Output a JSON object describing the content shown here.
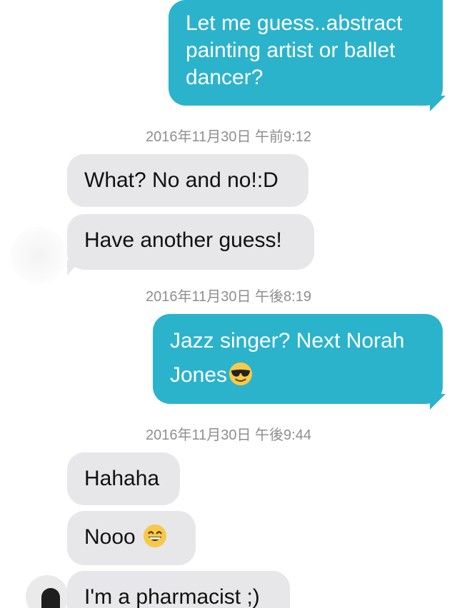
{
  "messages": [
    {
      "kind": "sent",
      "text": "Let me guess..abstract painting artist or ballet dancer?"
    },
    {
      "kind": "timestamp",
      "text": "2016年11月30日 午前9:12"
    },
    {
      "kind": "recv",
      "text": "What? No and no!:D"
    },
    {
      "kind": "recv",
      "text": "Have another guess!"
    },
    {
      "kind": "timestamp",
      "text": "2016年11月30日 午後8:19"
    },
    {
      "kind": "sent",
      "text_line1": "Jazz singer? Next Norah",
      "text_line2": "Jones",
      "emoji": "sunglasses-emoji"
    },
    {
      "kind": "timestamp",
      "text": "2016年11月30日 午後9:44"
    },
    {
      "kind": "recv",
      "text": "Hahaha"
    },
    {
      "kind": "recv",
      "text": "Nooo",
      "emoji": "grinning-emoji"
    },
    {
      "kind": "recv",
      "text": "I'm a pharmacist ;)"
    }
  ],
  "colors": {
    "sent_bubble": "#2bb3cc",
    "recv_bubble": "#e7e7e9",
    "timestamp": "#8e8e93"
  }
}
